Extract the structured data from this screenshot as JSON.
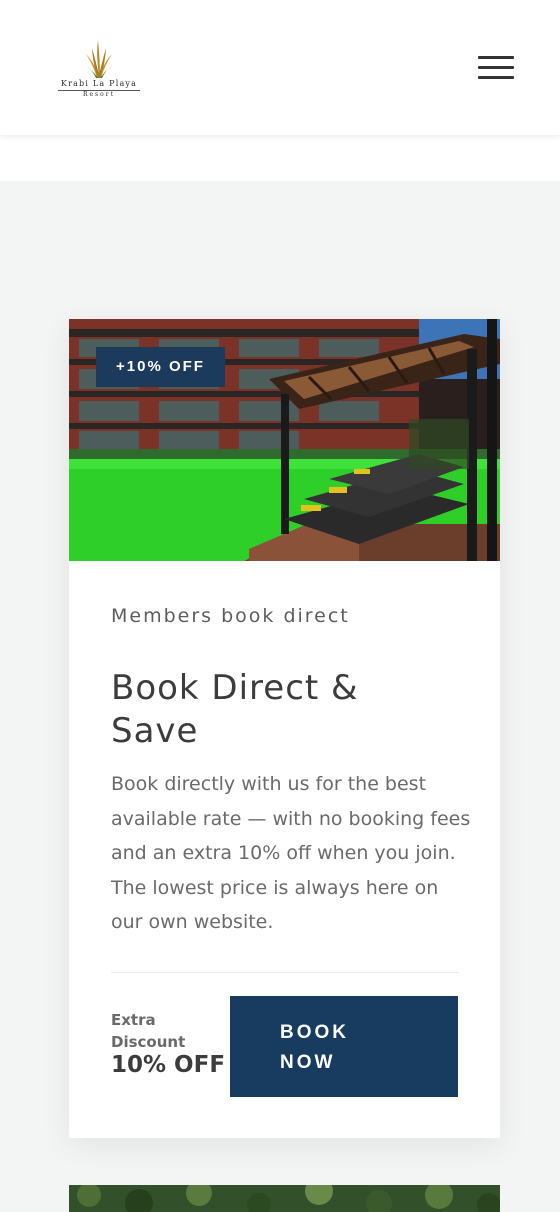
{
  "header": {
    "logo_name": "Krabi La Playa",
    "logo_sub": "Resort",
    "menu_icon": "hamburger-menu-icon"
  },
  "card": {
    "badge": "+10% OFF",
    "eyebrow": "Members book direct",
    "title": "Book Direct & Save",
    "description": "Book directly with us for the best available rate — with no booking fees and an extra 10% off when you join. The lowest price is always here on our own website.",
    "extra_label": "Extra Discount",
    "extra_value": "10% OFF",
    "button_label": "BOOK NOW"
  },
  "colors": {
    "accent": "#1b3a5c",
    "page_bg": "#f3f4f4"
  }
}
